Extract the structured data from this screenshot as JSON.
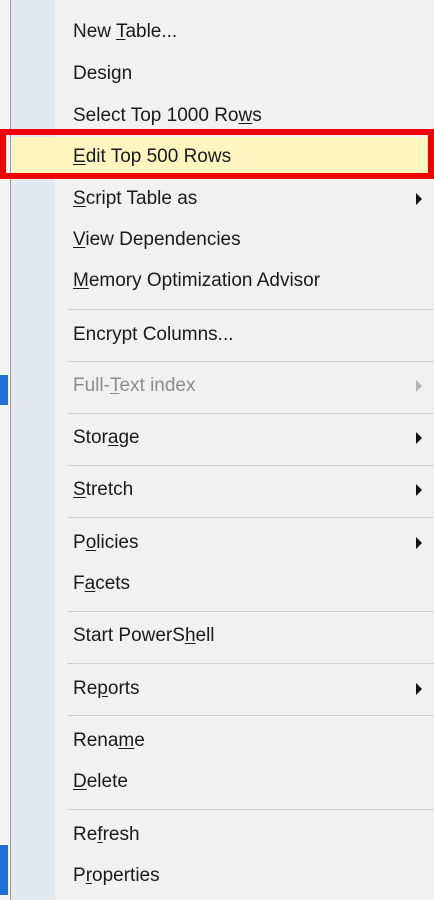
{
  "menu": {
    "items": [
      {
        "id": "new-table",
        "pre": "New ",
        "acc": "T",
        "post": "able...",
        "arrow": false,
        "disabled": false
      },
      {
        "id": "design",
        "pre": "Desi",
        "acc": "g",
        "post": "n",
        "arrow": false,
        "disabled": false
      },
      {
        "id": "select-top",
        "pre": "Select Top 1000 Ro",
        "acc": "w",
        "post": "s",
        "arrow": false,
        "disabled": false
      },
      {
        "id": "edit-top",
        "pre": "",
        "acc": "E",
        "post": "dit Top 500 Rows",
        "arrow": false,
        "disabled": false
      },
      {
        "id": "script-table",
        "pre": "",
        "acc": "S",
        "post": "cript Table as",
        "arrow": true,
        "disabled": false
      },
      {
        "id": "view-deps",
        "pre": "",
        "acc": "V",
        "post": "iew Dependencies",
        "arrow": false,
        "disabled": false
      },
      {
        "id": "memory-opt",
        "pre": "",
        "acc": "M",
        "post": "emory Optimization Advisor",
        "arrow": false,
        "disabled": false
      },
      {
        "id": "encrypt",
        "pre": "Encrypt Columns...",
        "acc": "",
        "post": "",
        "arrow": false,
        "disabled": false
      },
      {
        "id": "fulltext",
        "pre": "Full-",
        "acc": "T",
        "post": "ext index",
        "arrow": true,
        "disabled": true
      },
      {
        "id": "storage",
        "pre": "Stor",
        "acc": "a",
        "post": "ge",
        "arrow": true,
        "disabled": false
      },
      {
        "id": "stretch",
        "pre": "",
        "acc": "S",
        "post": "tretch",
        "arrow": true,
        "disabled": false
      },
      {
        "id": "policies",
        "pre": "P",
        "acc": "o",
        "post": "licies",
        "arrow": true,
        "disabled": false
      },
      {
        "id": "facets",
        "pre": "F",
        "acc": "a",
        "post": "cets",
        "arrow": false,
        "disabled": false
      },
      {
        "id": "powershell",
        "pre": "Start PowerS",
        "acc": "h",
        "post": "ell",
        "arrow": false,
        "disabled": false
      },
      {
        "id": "reports",
        "pre": "Re",
        "acc": "p",
        "post": "orts",
        "arrow": true,
        "disabled": false
      },
      {
        "id": "rename",
        "pre": "Rena",
        "acc": "m",
        "post": "e",
        "arrow": false,
        "disabled": false
      },
      {
        "id": "delete",
        "pre": "",
        "acc": "D",
        "post": "elete",
        "arrow": false,
        "disabled": false
      },
      {
        "id": "refresh",
        "pre": "Re",
        "acc": "f",
        "post": "resh",
        "arrow": false,
        "disabled": false
      },
      {
        "id": "properties",
        "pre": "P",
        "acc": "r",
        "post": "operties",
        "arrow": false,
        "disabled": false
      }
    ],
    "highlighted": "edit-top",
    "colors": {
      "highlight_bg": "#fff6bf",
      "highlight_border": "#f00000",
      "gutter": "#e4e8f3"
    }
  }
}
